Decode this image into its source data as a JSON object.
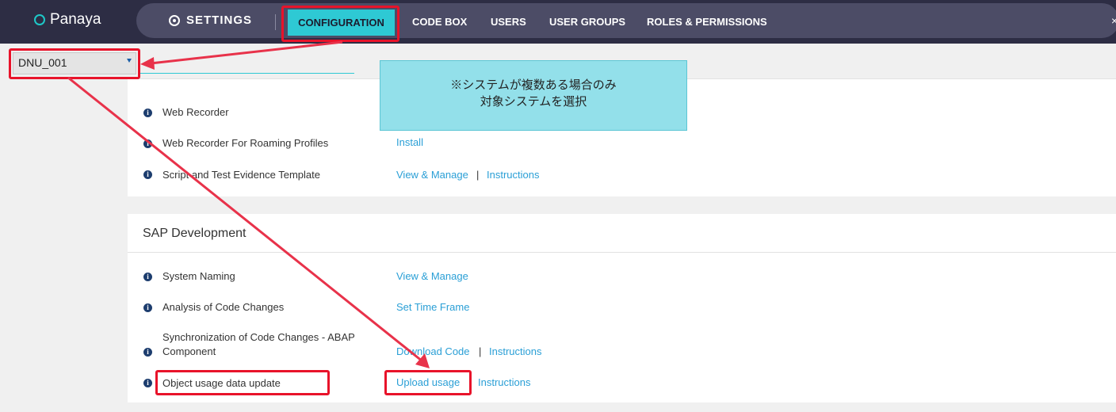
{
  "brand": {
    "name": "Panaya"
  },
  "nav": {
    "settings_label": "SETTINGS",
    "tabs": [
      "CONFIGURATION",
      "CODE BOX",
      "USERS",
      "USER GROUPS",
      "ROLES & PERMISSIONS"
    ],
    "active_tab": "CONFIGURATION",
    "close_symbol": "×"
  },
  "system_select": {
    "value": "DNU_001"
  },
  "callout": {
    "line1": "※システムが複数ある場合のみ",
    "line2": "対象システムを選択"
  },
  "panel1": {
    "rows": [
      {
        "label": "Web Recorder",
        "links": []
      },
      {
        "label": "Web Recorder For Roaming Profiles",
        "links": [
          "Install"
        ]
      },
      {
        "label": "Script and Test Evidence Template",
        "links": [
          "View & Manage",
          "Instructions"
        ]
      }
    ]
  },
  "panel2": {
    "title": "SAP Development",
    "rows": [
      {
        "label": "System Naming",
        "links": [
          "View & Manage"
        ]
      },
      {
        "label": "Analysis of Code Changes",
        "links": [
          "Set Time Frame"
        ]
      },
      {
        "label_line1": "Synchronization of Code Changes - ABAP",
        "label_line2": "Component",
        "links": [
          "Download Code",
          "Instructions"
        ]
      },
      {
        "label": "Object usage data update",
        "links": [
          "Upload usage",
          "Instructions"
        ]
      }
    ]
  },
  "icons": {
    "info": "info-icon",
    "gear": "gear-icon",
    "caret": "caret-down-icon"
  },
  "colors": {
    "accent": "#2ec9d4",
    "highlight": "#e8132a",
    "link": "#2a9fd6",
    "nav": "#2d2d44"
  }
}
